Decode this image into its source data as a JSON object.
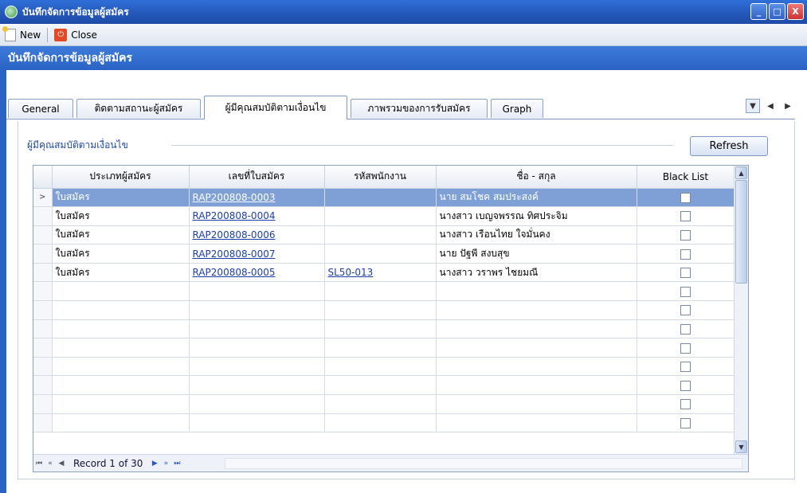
{
  "window": {
    "title": "บันทึกจัดการข้อมูลผู้สมัคร",
    "buttons": {
      "minimize": "_",
      "maximize": "□",
      "close": "X"
    }
  },
  "toolbar": {
    "new_label": "New",
    "close_label": "Close"
  },
  "header": {
    "title": "บันทึกจัดการข้อมูลผู้สมัคร"
  },
  "tabs": [
    {
      "label": "General"
    },
    {
      "label": "ติดตามสถานะผู้สมัคร"
    },
    {
      "label": "ผู้มีคุณสมบัติตามเงื่อนไข",
      "active": true
    },
    {
      "label": "ภาพรวมของการรับสมัคร"
    },
    {
      "label": "Graph"
    }
  ],
  "group": {
    "title": "ผู้มีคุณสมบัติตามเงื่อนไข",
    "refresh_label": "Refresh"
  },
  "grid": {
    "columns": [
      "ประเภทผู้สมัคร",
      "เลขที่ใบสมัคร",
      "รหัสพนักงาน",
      "ชื่อ - สกุล",
      "Black List"
    ],
    "rows": [
      {
        "type": "ใบสมัคร",
        "app_no": "RAP200808-0003",
        "emp_id": "",
        "name": "นาย สมโชค สมประสงค์",
        "blacklist": false,
        "selected": true
      },
      {
        "type": "ใบสมัคร",
        "app_no": "RAP200808-0004",
        "emp_id": "",
        "name": "นางสาว เบญจพรรณ ทิศประจิม",
        "blacklist": false
      },
      {
        "type": "ใบสมัคร",
        "app_no": "RAP200808-0006",
        "emp_id": "",
        "name": "นางสาว เรือนไทย ใจมั่นคง",
        "blacklist": false
      },
      {
        "type": "ใบสมัคร",
        "app_no": "RAP200808-0007",
        "emp_id": "",
        "name": "นาย ปัฐพี สงบสุข",
        "blacklist": false
      },
      {
        "type": "ใบสมัคร",
        "app_no": "RAP200808-0005",
        "emp_id": "SL50-013",
        "name": "นางสาว วราพร ไชยมณี",
        "blacklist": false
      }
    ],
    "empty_rows": 8,
    "record_text": "Record 1 of 30"
  }
}
